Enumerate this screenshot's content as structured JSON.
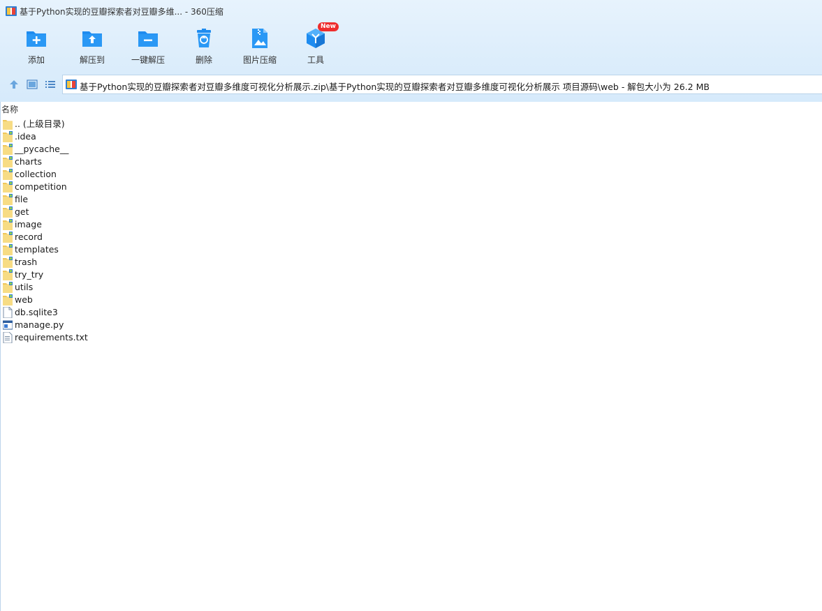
{
  "window": {
    "title": "基于Python实现的豆瓣探索者对豆瓣多维... - 360压缩"
  },
  "toolbar": {
    "tools": [
      {
        "label": "添加",
        "icon": "folder-add-icon"
      },
      {
        "label": "解压到",
        "icon": "folder-extract-icon"
      },
      {
        "label": "一键解压",
        "icon": "folder-oneclick-extract-icon"
      },
      {
        "label": "删除",
        "icon": "trash-icon"
      },
      {
        "label": "图片压缩",
        "icon": "image-compress-icon"
      },
      {
        "label": "工具",
        "icon": "tools-cube-icon",
        "badge": "New"
      }
    ]
  },
  "nav": {
    "up_icon": "arrow-up-icon",
    "view_icon": "view-thumbnail-icon",
    "list_icon": "view-list-icon",
    "path": "基于Python实现的豆瓣探索者对豆瓣多维度可视化分析展示.zip\\基于Python实现的豆瓣探索者对豆瓣多维度可视化分析展示 项目源码\\web - 解包大小为 26.2 MB"
  },
  "list": {
    "column_name": "名称",
    "items": [
      {
        "name": ".. (上级目录)",
        "type": "parent"
      },
      {
        "name": ".idea",
        "type": "folder"
      },
      {
        "name": "__pycache__",
        "type": "folder"
      },
      {
        "name": "charts",
        "type": "folder"
      },
      {
        "name": "collection",
        "type": "folder"
      },
      {
        "name": "competition",
        "type": "folder"
      },
      {
        "name": "file",
        "type": "folder"
      },
      {
        "name": "get",
        "type": "folder"
      },
      {
        "name": "image",
        "type": "folder"
      },
      {
        "name": "record",
        "type": "folder"
      },
      {
        "name": "templates",
        "type": "folder"
      },
      {
        "name": "trash",
        "type": "folder"
      },
      {
        "name": "try_try",
        "type": "folder"
      },
      {
        "name": "utils",
        "type": "folder"
      },
      {
        "name": "web",
        "type": "folder"
      },
      {
        "name": "db.sqlite3",
        "type": "file"
      },
      {
        "name": "manage.py",
        "type": "python"
      },
      {
        "name": "requirements.txt",
        "type": "text"
      }
    ]
  },
  "colors": {
    "accent": "#1e8cf0",
    "folder": "#f5d777",
    "badge": "#ee2d2d"
  }
}
